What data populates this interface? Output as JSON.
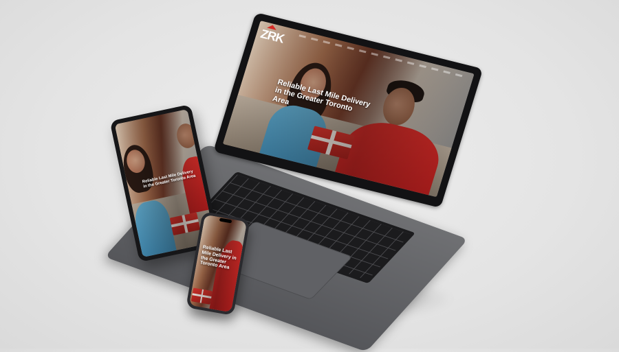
{
  "laptop": {
    "logo_text": "ZRK",
    "headline": "Reliable Last Mile Delivery in the Greater Toronto Area"
  },
  "tablet": {
    "headline": "Reliable Last Mile Delivery in the Greater Toronto Area"
  },
  "phone": {
    "headline": "Reliable Last Mile Delivery in the Greater Toronto Area"
  },
  "colors": {
    "brand_red": "#d52a26",
    "shirt_blue": "#4a93bb",
    "background": "#e6e6e6"
  }
}
